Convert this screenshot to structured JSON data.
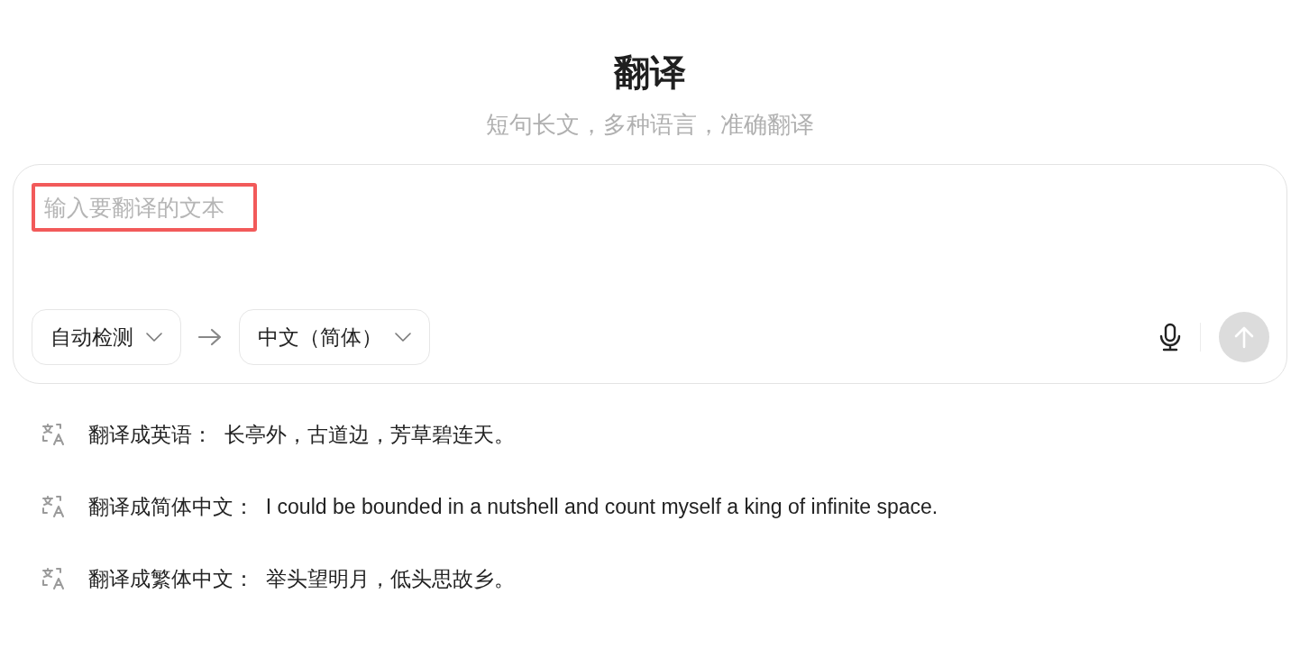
{
  "header": {
    "title": "翻译",
    "subtitle": "短句长文，多种语言，准确翻译"
  },
  "input": {
    "placeholder": "输入要翻译的文本",
    "highlighted": true
  },
  "source_language": "自动检测",
  "target_language": "中文（简体）",
  "send_button": {
    "disabled": true
  },
  "suggestions": [
    {
      "text": "翻译成英语：  长亭外，古道边，芳草碧连天。"
    },
    {
      "text": "翻译成简体中文：  I could be bounded in a nutshell and count myself a king of infinite space."
    },
    {
      "text": "翻译成繁体中文：  举头望明月，低头思故乡。"
    }
  ]
}
